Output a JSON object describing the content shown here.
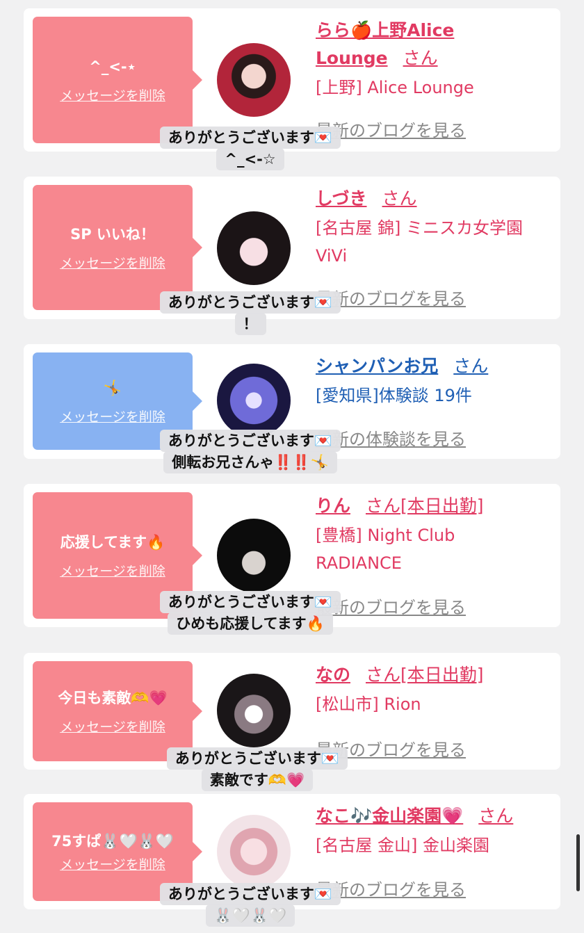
{
  "cards": [
    {
      "bubble_msg": "^_<-⋆",
      "delete_label": "メッセージを削除",
      "name": "らら🍎上野Alice Lounge",
      "san": "さん",
      "tag": "",
      "shop": "[上野] Alice Lounge",
      "link": "最新のブログを見る",
      "overlay_line1": "ありがとうございます💌",
      "overlay_line2": "^_<-☆"
    },
    {
      "bubble_msg": "SP いいね！",
      "delete_label": "メッセージを削除",
      "name": "しづき",
      "san": "さん",
      "tag": "",
      "shop": "[名古屋 錦] ミニスカ女学園ViVi",
      "link": "最新のブログを見る",
      "overlay_line1": "ありがとうございます💌",
      "overlay_line2": "！"
    },
    {
      "bubble_msg": "🤸",
      "delete_label": "メッセージを削除",
      "name": "シャンパンお兄",
      "san": "さん",
      "tag": "",
      "shop": "[愛知県]体験談 19件",
      "link": "最新の体験談を見る",
      "overlay_line1": "ありがとうございます💌",
      "overlay_line2": "側転お兄さんゃ‼️‼️🤸"
    },
    {
      "bubble_msg": "応援してます🔥",
      "delete_label": "メッセージを削除",
      "name": "りん",
      "san": "さん",
      "tag": "[本日出勤]",
      "shop": "[豊橋] Night Club RADIANCE",
      "link": "最新のブログを見る",
      "overlay_line1": "ありがとうございます💌",
      "overlay_line2": "ひめも応援してます🔥"
    },
    {
      "bubble_msg": "今日も素敵🫶💗",
      "delete_label": "メッセージを削除",
      "name": "なの",
      "san": "さん",
      "tag": "[本日出勤]",
      "shop": "[松山市] Rion",
      "link": "最新のブログを見る",
      "overlay_line1": "ありがとうございます💌",
      "overlay_line2": "素敵です🫶💗"
    },
    {
      "bubble_msg": "75すぱ🐰🤍🐰🤍",
      "delete_label": "メッセージを削除",
      "name": "なこ🎶金山楽園💗",
      "san": "さん",
      "tag": "",
      "shop": "[名古屋 金山] 金山楽園",
      "link": "最新のブログを見る",
      "overlay_line1": "ありがとうございます💌",
      "overlay_line2": "🐰🤍🐰🤍"
    }
  ],
  "colors": {
    "pink_bubble": "#f7878f",
    "blue_bubble": "#88b2f2",
    "pink_text": "#e13a62",
    "blue_text": "#1f5fb4"
  }
}
